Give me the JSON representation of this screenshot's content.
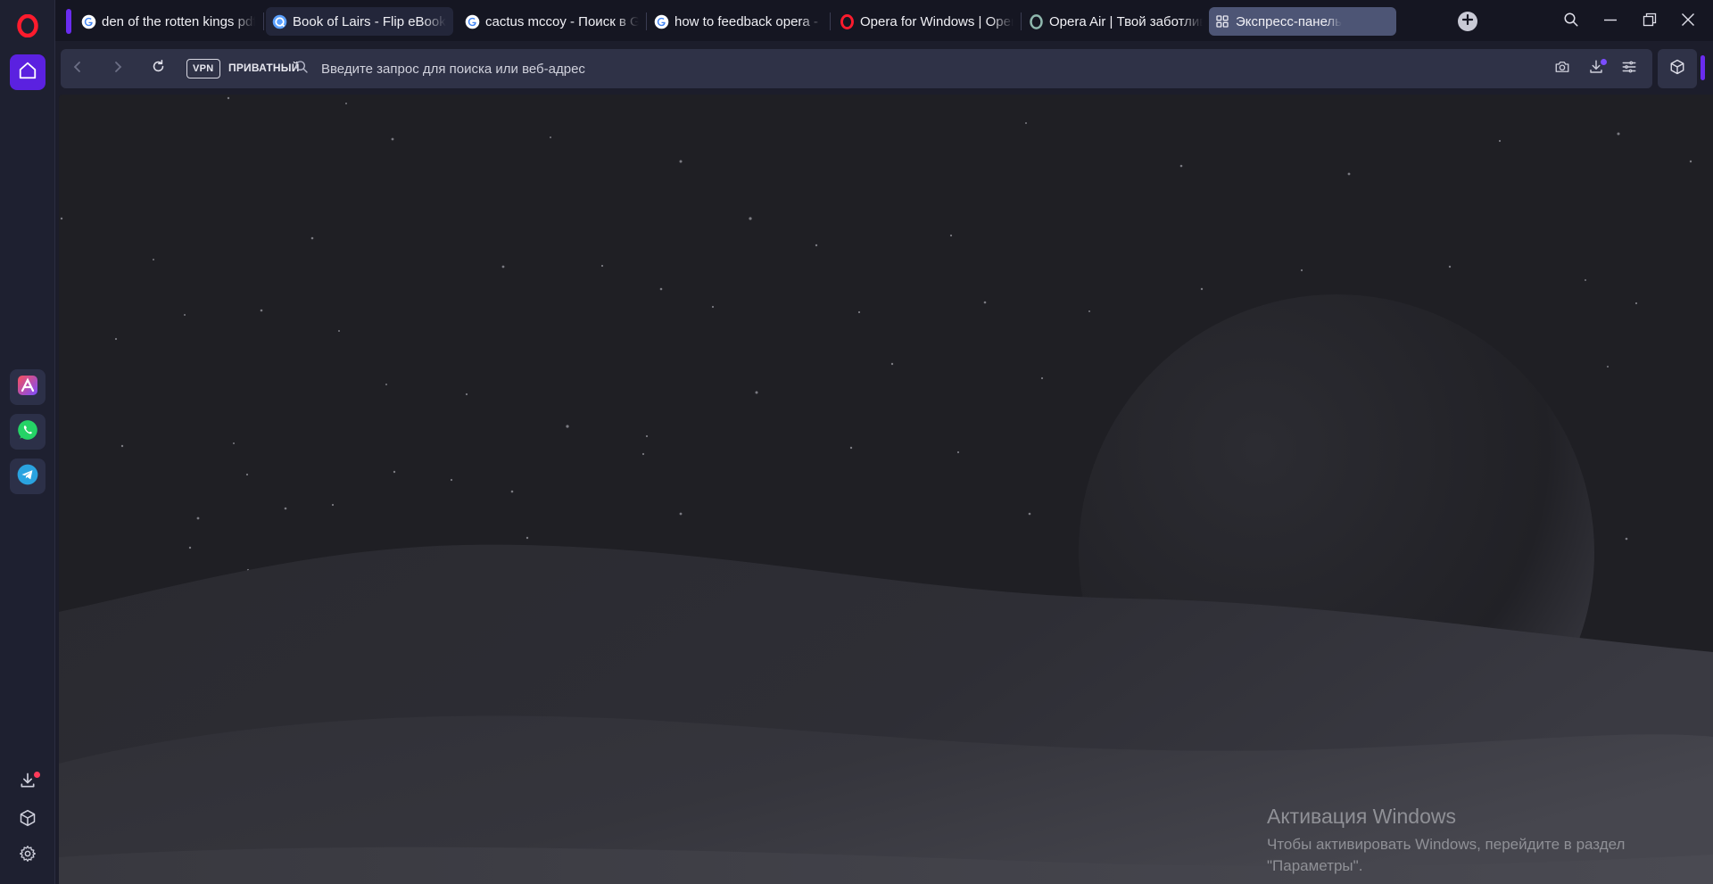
{
  "window": {
    "search_icon": "search-icon",
    "minimize_icon": "minimize-icon",
    "restore_icon": "restore-icon",
    "close_icon": "close-icon"
  },
  "tabs": [
    {
      "title": "den of the rotten kings pdf",
      "favicon": "google-icon"
    },
    {
      "title": "Book of Lairs - Flip eBook",
      "favicon": "flip-ebook-icon"
    },
    {
      "title": "cactus mccoy - Поиск в Google",
      "favicon": "google-icon"
    },
    {
      "title": "how to feedback opera - Поиск",
      "favicon": "google-icon"
    },
    {
      "title": "Opera for Windows | Opera",
      "favicon": "opera-icon"
    },
    {
      "title": "Opera Air | Твой заботливый",
      "favicon": "opera-air-icon"
    },
    {
      "title": "Экспресс-панель",
      "favicon": "speed-dial-icon",
      "active": true
    }
  ],
  "toolbar": {
    "vpn_label": "VPN",
    "private_label": "ПРИВАТНЫЙ",
    "address_placeholder": "Введите запрос для поиска или веб-адрес",
    "address_value": ""
  },
  "sidebar": {
    "top": [
      "opera-logo-icon",
      "home-icon"
    ],
    "apps": [
      "aria-icon",
      "whatsapp-icon",
      "telegram-icon"
    ],
    "bottom": [
      "download-icon",
      "extensions-icon",
      "settings-icon"
    ]
  },
  "colors": {
    "accent": "#5b21e0",
    "tab_active": "#4d5575",
    "background": "#1c1d2b"
  },
  "activation": {
    "title": "Активация Windows",
    "line1": "Чтобы активировать Windows, перейдите в раздел",
    "line2": "\"Параметры\"."
  }
}
